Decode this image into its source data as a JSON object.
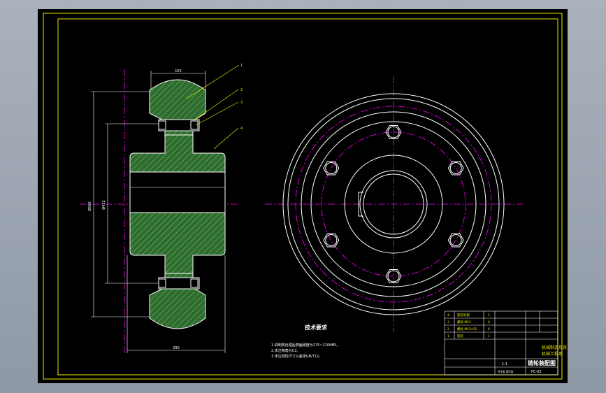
{
  "notes": {
    "title": "技术要求",
    "lines": [
      "1.调制热处理后表面硬度为175~210HBS。",
      "2.未注倒角为C2。",
      "3.未注线性尺寸公差按GB/T12。"
    ]
  },
  "title_block": {
    "drawing_title": "链轮装配图",
    "drawing_no": "PC-02",
    "org_line1": "机械制造及其自动化",
    "org_line2": "机械工程系",
    "scale": "1:1",
    "sheet": "共1张 第1张"
  },
  "dimensions": {
    "top_width": "155",
    "bottom_width": "290",
    "height_outer": "Ø560",
    "height_inner": "Ø432"
  },
  "balloons": [
    "1",
    "2",
    "3",
    "4"
  ],
  "parts": [
    {
      "no": "4",
      "name": "链轮轮毂",
      "qty": "1"
    },
    {
      "no": "3",
      "name": "螺母 M12",
      "qty": "6"
    },
    {
      "no": "2",
      "name": "螺栓 M12x55",
      "qty": "6"
    },
    {
      "no": "1",
      "name": "链轮",
      "qty": "1"
    }
  ],
  "colors": {
    "border": "#e8e800",
    "outline": "#ffffff",
    "centerline": "#ff00ff",
    "section_fill": "#3a7a3a",
    "hatch": "#7fd07f"
  }
}
